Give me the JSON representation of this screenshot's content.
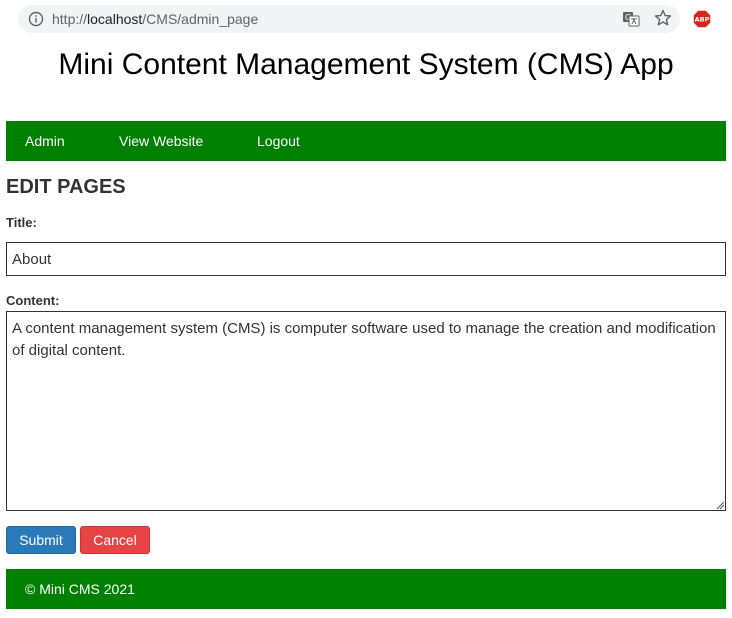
{
  "browser": {
    "url_prefix": "http://",
    "url_host": "localhost",
    "url_path": "/CMS/admin_page",
    "abp_label": "ABP"
  },
  "page": {
    "title": "Mini Content Management System (CMS) App"
  },
  "nav": {
    "items": [
      {
        "label": "Admin"
      },
      {
        "label": "View Website"
      },
      {
        "label": "Logout"
      }
    ]
  },
  "form": {
    "heading": "EDIT PAGES",
    "title_label": "Title:",
    "title_value": "About",
    "content_label": "Content:",
    "content_value": "A content management system (CMS) is computer software used to manage the creation and modification of digital content.",
    "submit_label": "Submit",
    "cancel_label": "Cancel"
  },
  "footer": {
    "text": "© Mini CMS 2021"
  },
  "colors": {
    "nav_bg": "#008000",
    "submit_bg": "#2a7ab9",
    "cancel_bg": "#e64444"
  }
}
